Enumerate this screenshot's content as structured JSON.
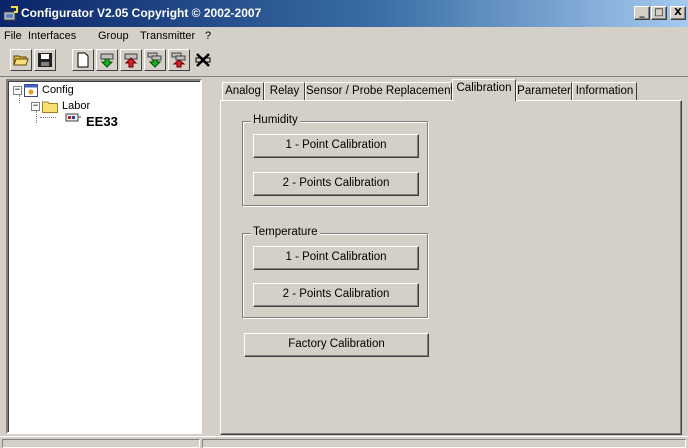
{
  "window": {
    "title": "Configurator  V2.05 Copyright © 2002-2007",
    "controls": [
      "_",
      "□",
      "X"
    ]
  },
  "menu": [
    "File",
    "Interfaces",
    "Group",
    "Transmitter",
    "?"
  ],
  "toolbar": {
    "buttons": [
      "open-folder-icon",
      "save-disk-icon",
      "new-document-icon",
      "download-green-icon",
      "upload-red-icon",
      "download-group-green-icon",
      "upload-group-red-icon",
      "disconnect-icon"
    ]
  },
  "tree": {
    "root": "Config",
    "group": "Labor",
    "device": "EE33"
  },
  "tabs": [
    "Analog",
    "Relay",
    "Sensor / Probe Replacement",
    "Calibration",
    "Parameter",
    "Information"
  ],
  "active_tab": "Calibration",
  "calibration": {
    "humidity": {
      "legend": "Humidity",
      "one_point": "1 - Point Calibration",
      "two_points": "2 - Points Calibration"
    },
    "temperature": {
      "legend": "Temperature",
      "one_point": "1 - Point Calibration",
      "two_points": "2 - Points Calibration"
    },
    "factory": "Factory Calibration"
  }
}
